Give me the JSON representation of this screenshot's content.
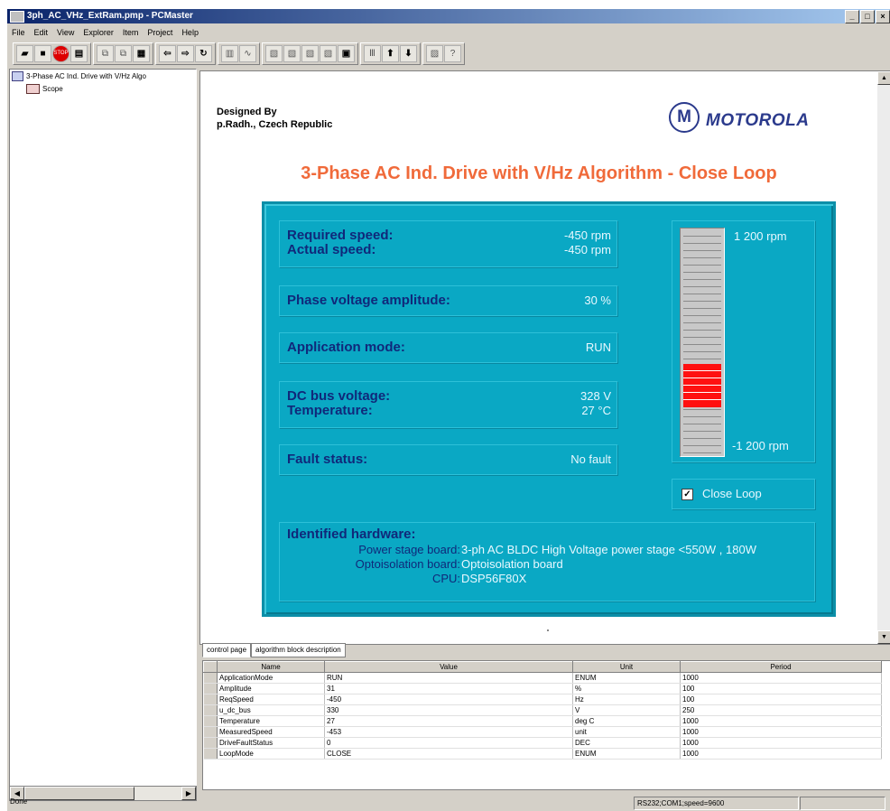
{
  "window": {
    "title": "3ph_AC_VHz_ExtRam.pmp - PCMaster"
  },
  "menu": [
    "File",
    "Edit",
    "View",
    "Explorer",
    "Item",
    "Project",
    "Help"
  ],
  "tree": {
    "root": "3-Phase AC Ind. Drive with V/Hz Algo",
    "child": "Scope"
  },
  "page": {
    "designed_by": "Designed By",
    "author": "p.Radh., Czech Republic",
    "logo_text": "MOTOROLA",
    "title": "3-Phase AC Ind. Drive with V/Hz Algorithm - Close Loop"
  },
  "panel": {
    "required_speed_label": "Required speed:",
    "required_speed_value": "-450 rpm",
    "actual_speed_label": "Actual speed:",
    "actual_speed_value": "-450 rpm",
    "phase_voltage_label": "Phase voltage amplitude:",
    "phase_voltage_value": "30 %",
    "app_mode_label": "Application mode:",
    "app_mode_value": "RUN",
    "dc_bus_label": "DC bus voltage:",
    "dc_bus_value": "328 V",
    "temperature_label": "Temperature:",
    "temperature_value": "27 °C",
    "fault_label": "Fault status:",
    "fault_value": "No fault",
    "gauge_max": "1 200 rpm",
    "gauge_min": "-1 200 rpm",
    "close_loop_label": "Close Loop",
    "close_loop_checked": true,
    "hw_title": "Identified hardware:",
    "hw_power_label": "Power stage board:",
    "hw_power_value": "3-ph AC BLDC High Voltage power stage <550W , 180W",
    "hw_opto_label": "Optoisolation board:",
    "hw_opto_value": "Optoisolation board",
    "hw_cpu_label": "CPU:",
    "hw_cpu_value": "DSP56F80X"
  },
  "tabs": [
    "control page",
    "algorithm block description"
  ],
  "grid": {
    "columns": [
      "Name",
      "Value",
      "Unit",
      "Period"
    ],
    "rows": [
      [
        "ApplicationMode",
        "RUN",
        "ENUM",
        "1000"
      ],
      [
        "Amplitude",
        "31",
        "%",
        "100"
      ],
      [
        "ReqSpeed",
        "-450",
        "Hz",
        "100"
      ],
      [
        "u_dc_bus",
        "330",
        "V",
        "250"
      ],
      [
        "Temperature",
        "27",
        "deg C",
        "1000"
      ],
      [
        "MeasuredSpeed",
        "-453",
        "unit",
        "1000"
      ],
      [
        "DriveFaultStatus",
        "0",
        "DEC",
        "1000"
      ],
      [
        "LoopMode",
        "CLOSE",
        "ENUM",
        "1000"
      ]
    ]
  },
  "status": {
    "left": "Done",
    "comm": "RS232;COM1;speed=9600"
  }
}
